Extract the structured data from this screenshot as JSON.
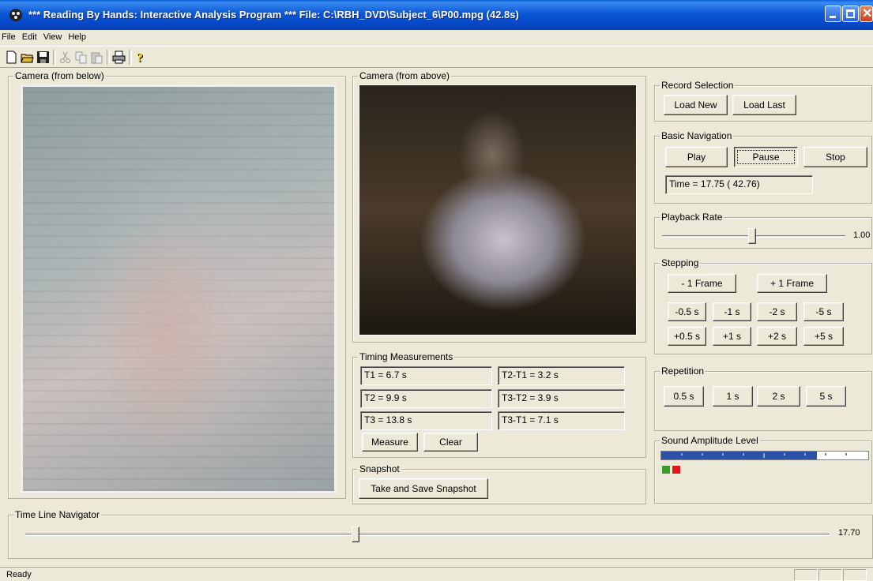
{
  "window": {
    "title": "*** Reading By Hands: Interactive Analysis Program ***   File: C:\\RBH_DVD\\Subject_6\\P00.mpg  (42.8s)"
  },
  "menu": [
    "File",
    "Edit",
    "View",
    "Help"
  ],
  "toolbar_icons": [
    "new-icon",
    "open-icon",
    "save-icon",
    "cut-icon",
    "copy-icon",
    "paste-icon",
    "print-icon",
    "help-icon"
  ],
  "camera_below": {
    "label": "Camera (from below)"
  },
  "camera_above": {
    "label": "Camera (from above)"
  },
  "record_selection": {
    "label": "Record Selection",
    "load_new": "Load New",
    "load_last": "Load Last"
  },
  "basic_navigation": {
    "label": "Basic Navigation",
    "play": "Play",
    "pause": "Pause",
    "stop": "Stop",
    "time": "Time = 17.75 ( 42.76)"
  },
  "playback_rate": {
    "label": "Playback Rate",
    "value": "1.00",
    "position": 0.49
  },
  "stepping": {
    "label": "Stepping",
    "frame_back": "- 1 Frame",
    "frame_fwd": "+ 1 Frame",
    "back": [
      "-0.5 s",
      "-1 s",
      "-2 s",
      "-5 s"
    ],
    "fwd": [
      "+0.5 s",
      "+1 s",
      "+2 s",
      "+5 s"
    ]
  },
  "repetition": {
    "label": "Repetition",
    "buttons": [
      "0.5 s",
      "1 s",
      "2 s",
      "5 s"
    ]
  },
  "sound": {
    "label": "Sound Amplitude Level",
    "level": 0.75
  },
  "timing": {
    "label": "Timing Measurements",
    "t1": "T1 =  6.7 s",
    "t2": "T2 =  9.9 s",
    "t3": "T3 = 13.8 s",
    "t2t1": "T2-T1 =  3.2 s",
    "t3t2": "T3-T2 =  3.9 s",
    "t3t1": "T3-T1 =  7.1 s",
    "measure": "Measure",
    "clear": "Clear"
  },
  "snapshot": {
    "label": "Snapshot",
    "button": "Take and Save Snapshot"
  },
  "timeline": {
    "label": "Time Line Navigator",
    "value": "17.70",
    "position": 0.41
  },
  "status": {
    "text": "Ready"
  }
}
